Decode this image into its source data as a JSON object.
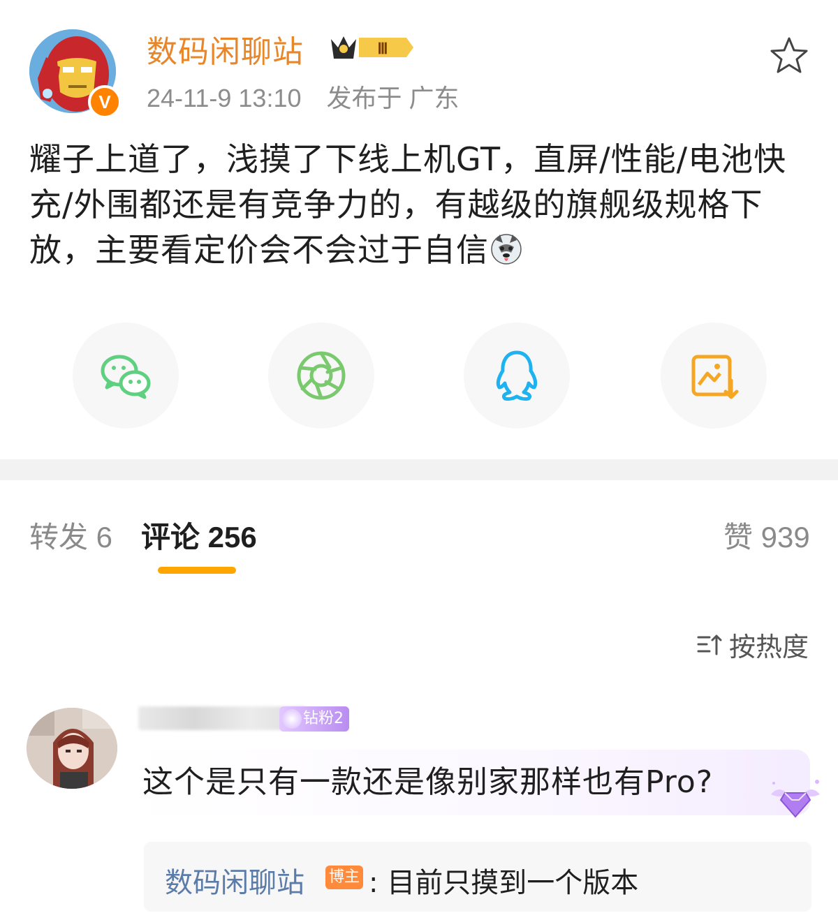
{
  "post": {
    "author": "数码闲聊站",
    "level_badge": "Ⅲ",
    "verified_mark": "V",
    "time": "24-11-9 13:10",
    "location": "发布于 广东",
    "text": "耀子上道了，浅摸了下线上机GT，直屏/性能/电池快充/外围都还是有竞争力的，有越级的旗舰级规格下放，主要看定价会不会过于自信",
    "emoji": "husky-emoji"
  },
  "share": {
    "items": [
      {
        "icon": "wechat-icon",
        "color": "#5fcf80"
      },
      {
        "icon": "moments-icon",
        "color": "#7bc96f"
      },
      {
        "icon": "qq-icon",
        "color": "#1eb2f0"
      },
      {
        "icon": "save-image-icon",
        "color": "#f5a623"
      }
    ]
  },
  "tabs": {
    "repost": "转发 6",
    "comments": "评论 256",
    "likes": "赞 939"
  },
  "sort": {
    "label": "按热度",
    "icon": "sort-icon"
  },
  "comment": {
    "fan_badge": "钻粉2",
    "text": "这个是只有一款还是像别家那样也有Pro?",
    "reply": {
      "author": "数码闲聊站",
      "badge": "博主",
      "text": ": 目前只摸到一个版本"
    }
  },
  "colors": {
    "accent": "#ffa500",
    "author_name": "#e8862a",
    "reply_author": "#5b7ba8"
  }
}
